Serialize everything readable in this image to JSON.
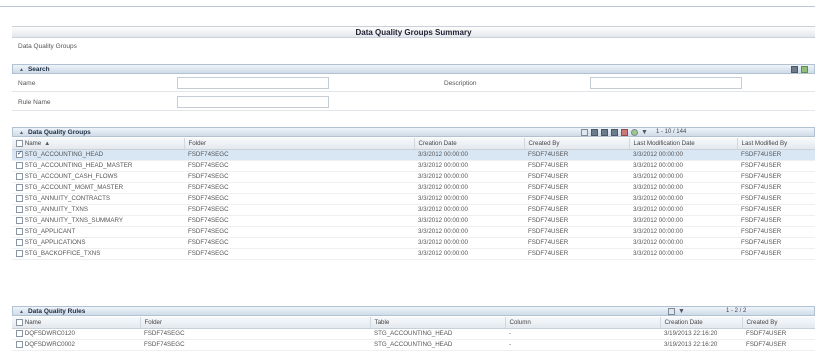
{
  "page": {
    "title": "Data Quality Groups Summary",
    "breadcrumb": "Data Quality Groups"
  },
  "search": {
    "header": "Search",
    "name_label": "Name",
    "description_label": "Description",
    "rule_name_label": "Rule Name",
    "name_value": "",
    "description_value": "",
    "rule_name_value": ""
  },
  "groups": {
    "header": "Data Quality Groups",
    "pager": "1 - 10 / 144",
    "columns": [
      "Name",
      "Folder",
      "Creation Date",
      "Created By",
      "Last Modification Date",
      "Last Modified By"
    ],
    "rows": [
      [
        "STG_ACCOUNTING_HEAD",
        "FSDF74SEGC",
        "3/3/2012 00:00:00",
        "FSDF74USER",
        "3/3/2012 00:00:00",
        "FSDF74USER"
      ],
      [
        "STG_ACCOUNTING_HEAD_MASTER",
        "FSDF74SEGC",
        "3/3/2012 00:00:00",
        "FSDF74USER",
        "3/3/2012 00:00:00",
        "FSDF74USER"
      ],
      [
        "STG_ACCOUNT_CASH_FLOWS",
        "FSDF74SEGC",
        "3/3/2012 00:00:00",
        "FSDF74USER",
        "3/3/2012 00:00:00",
        "FSDF74USER"
      ],
      [
        "STG_ACCOUNT_MGMT_MASTER",
        "FSDF74SEGC",
        "3/3/2012 00:00:00",
        "FSDF74USER",
        "3/3/2012 00:00:00",
        "FSDF74USER"
      ],
      [
        "STG_ANNUITY_CONTRACTS",
        "FSDF74SEGC",
        "3/3/2012 00:00:00",
        "FSDF74USER",
        "3/3/2012 00:00:00",
        "FSDF74USER"
      ],
      [
        "STG_ANNUITY_TXNS",
        "FSDF74SEGC",
        "3/3/2012 00:00:00",
        "FSDF74USER",
        "3/3/2012 00:00:00",
        "FSDF74USER"
      ],
      [
        "STG_ANNUITY_TXNS_SUMMARY",
        "FSDF74SEGC",
        "3/3/2012 00:00:00",
        "FSDF74USER",
        "3/3/2012 00:00:00",
        "FSDF74USER"
      ],
      [
        "STG_APPLICANT",
        "FSDF74SEGC",
        "3/3/2012 00:00:00",
        "FSDF74USER",
        "3/3/2012 00:00:00",
        "FSDF74USER"
      ],
      [
        "STG_APPLICATIONS",
        "FSDF74SEGC",
        "3/3/2012 00:00:00",
        "FSDF74USER",
        "3/3/2012 00:00:00",
        "FSDF74USER"
      ],
      [
        "STG_BACKOFFICE_TXNS",
        "FSDF74SEGC",
        "3/3/2012 00:00:00",
        "FSDF74USER",
        "3/3/2012 00:00:00",
        "FSDF74USER"
      ]
    ]
  },
  "rules": {
    "header": "Data Quality Rules",
    "pager": "1 - 2 / 2",
    "columns": [
      "Name",
      "Folder",
      "Table",
      "Column",
      "Creation Date",
      "Created By"
    ],
    "rows": [
      [
        "DQFSDWRC0120",
        "FSDF74SEGC",
        "STG_ACCOUNTING_HEAD",
        "-",
        "3/19/2013 22:16:20",
        "FSDF74USER"
      ],
      [
        "DQFSDWRC0002",
        "FSDF74SEGC",
        "STG_ACCOUNTING_HEAD",
        "-",
        "3/19/2013 22:16:20",
        "FSDF74USER"
      ]
    ]
  }
}
